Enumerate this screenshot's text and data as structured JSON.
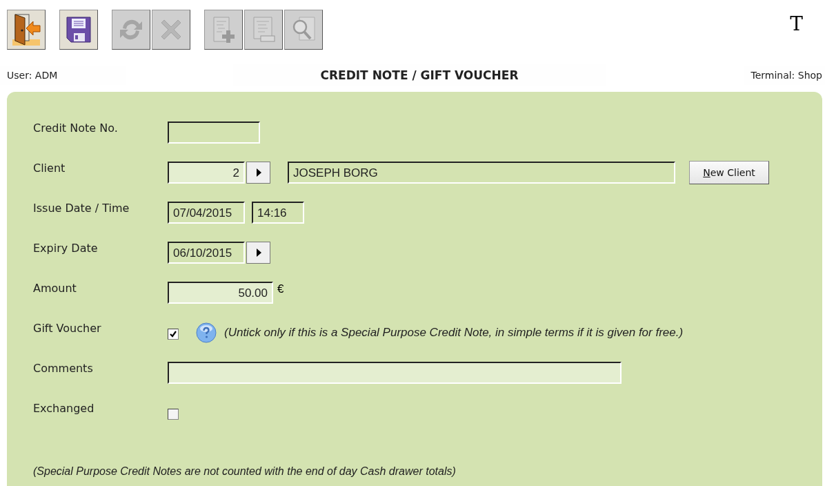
{
  "toolbar": [
    {
      "kind": "exit",
      "disabled": false
    },
    {
      "kind": "save",
      "disabled": false
    },
    {
      "kind": "refresh",
      "disabled": true
    },
    {
      "kind": "cancel",
      "disabled": true
    },
    {
      "kind": "doc-add",
      "disabled": true
    },
    {
      "kind": "doc",
      "disabled": true
    },
    {
      "kind": "doc-search",
      "disabled": true
    }
  ],
  "font_toggle": "T",
  "header": {
    "user": "User: ADM",
    "title": "CREDIT NOTE / GIFT VOUCHER",
    "terminal": "Terminal: Shop"
  },
  "form": [
    {
      "kind": "text",
      "label": "Credit Note No."
    },
    {
      "kind": "client",
      "label": "Client",
      "client_id": "2",
      "client_name": "JOSEPH BORG",
      "button": "New Client"
    },
    {
      "kind": "datetime",
      "label": "Issue Date / Time",
      "date": "07/04/2015",
      "time": "14:16"
    },
    {
      "kind": "date",
      "label": "Expiry Date",
      "date": "06/10/2015"
    },
    {
      "kind": "amount",
      "label": "Amount",
      "value": "50.00",
      "currency": "€"
    },
    {
      "kind": "checkbox",
      "label": "Gift Voucher",
      "checked": true,
      "note": "(Untick only if this is a Special Purpose Credit Note, in simple terms if it is given for free.)"
    },
    {
      "kind": "comments",
      "label": "Comments"
    },
    {
      "kind": "checkbox",
      "label": "Exchanged",
      "checked": false
    }
  ],
  "footnote": "(Special Purpose Credit Notes are not counted with the end of day Cash drawer totals)"
}
